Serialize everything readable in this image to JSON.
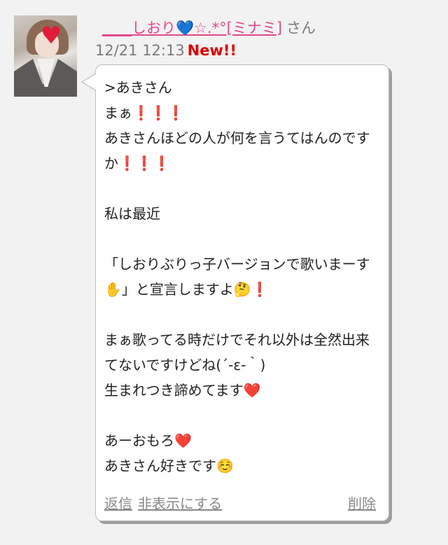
{
  "post": {
    "author_name": "____しおり💙☆.*°[ミナミ]",
    "author_suffix": "さん",
    "date": "12/21 12:13",
    "new_badge": "New!!",
    "message": ">あきさん\nまぁ❗️❗️❗️\nあきさんほどの人が何を言うてはんのですか❗️❗️❗️\n\n私は最近\n\n「しおりぶりっ子バージョンで歌いまーす✋」と宣言しますよ🤔❗️\n\nまぁ歌ってる時だけでそれ以外は全然出来てないですけどね(´-ε-｀)\n生まれつき諦めてます❤️\n\nあーおもろ❤️\nあきさん好きです☺️"
  },
  "actions": {
    "reply": "返信",
    "hide": "非表示にする",
    "delete": "削除"
  },
  "colors": {
    "name_pink": "#e0488c",
    "new_red": "#e00000",
    "meta_gray": "#7b7b7b",
    "background": "#f2f2f2"
  }
}
